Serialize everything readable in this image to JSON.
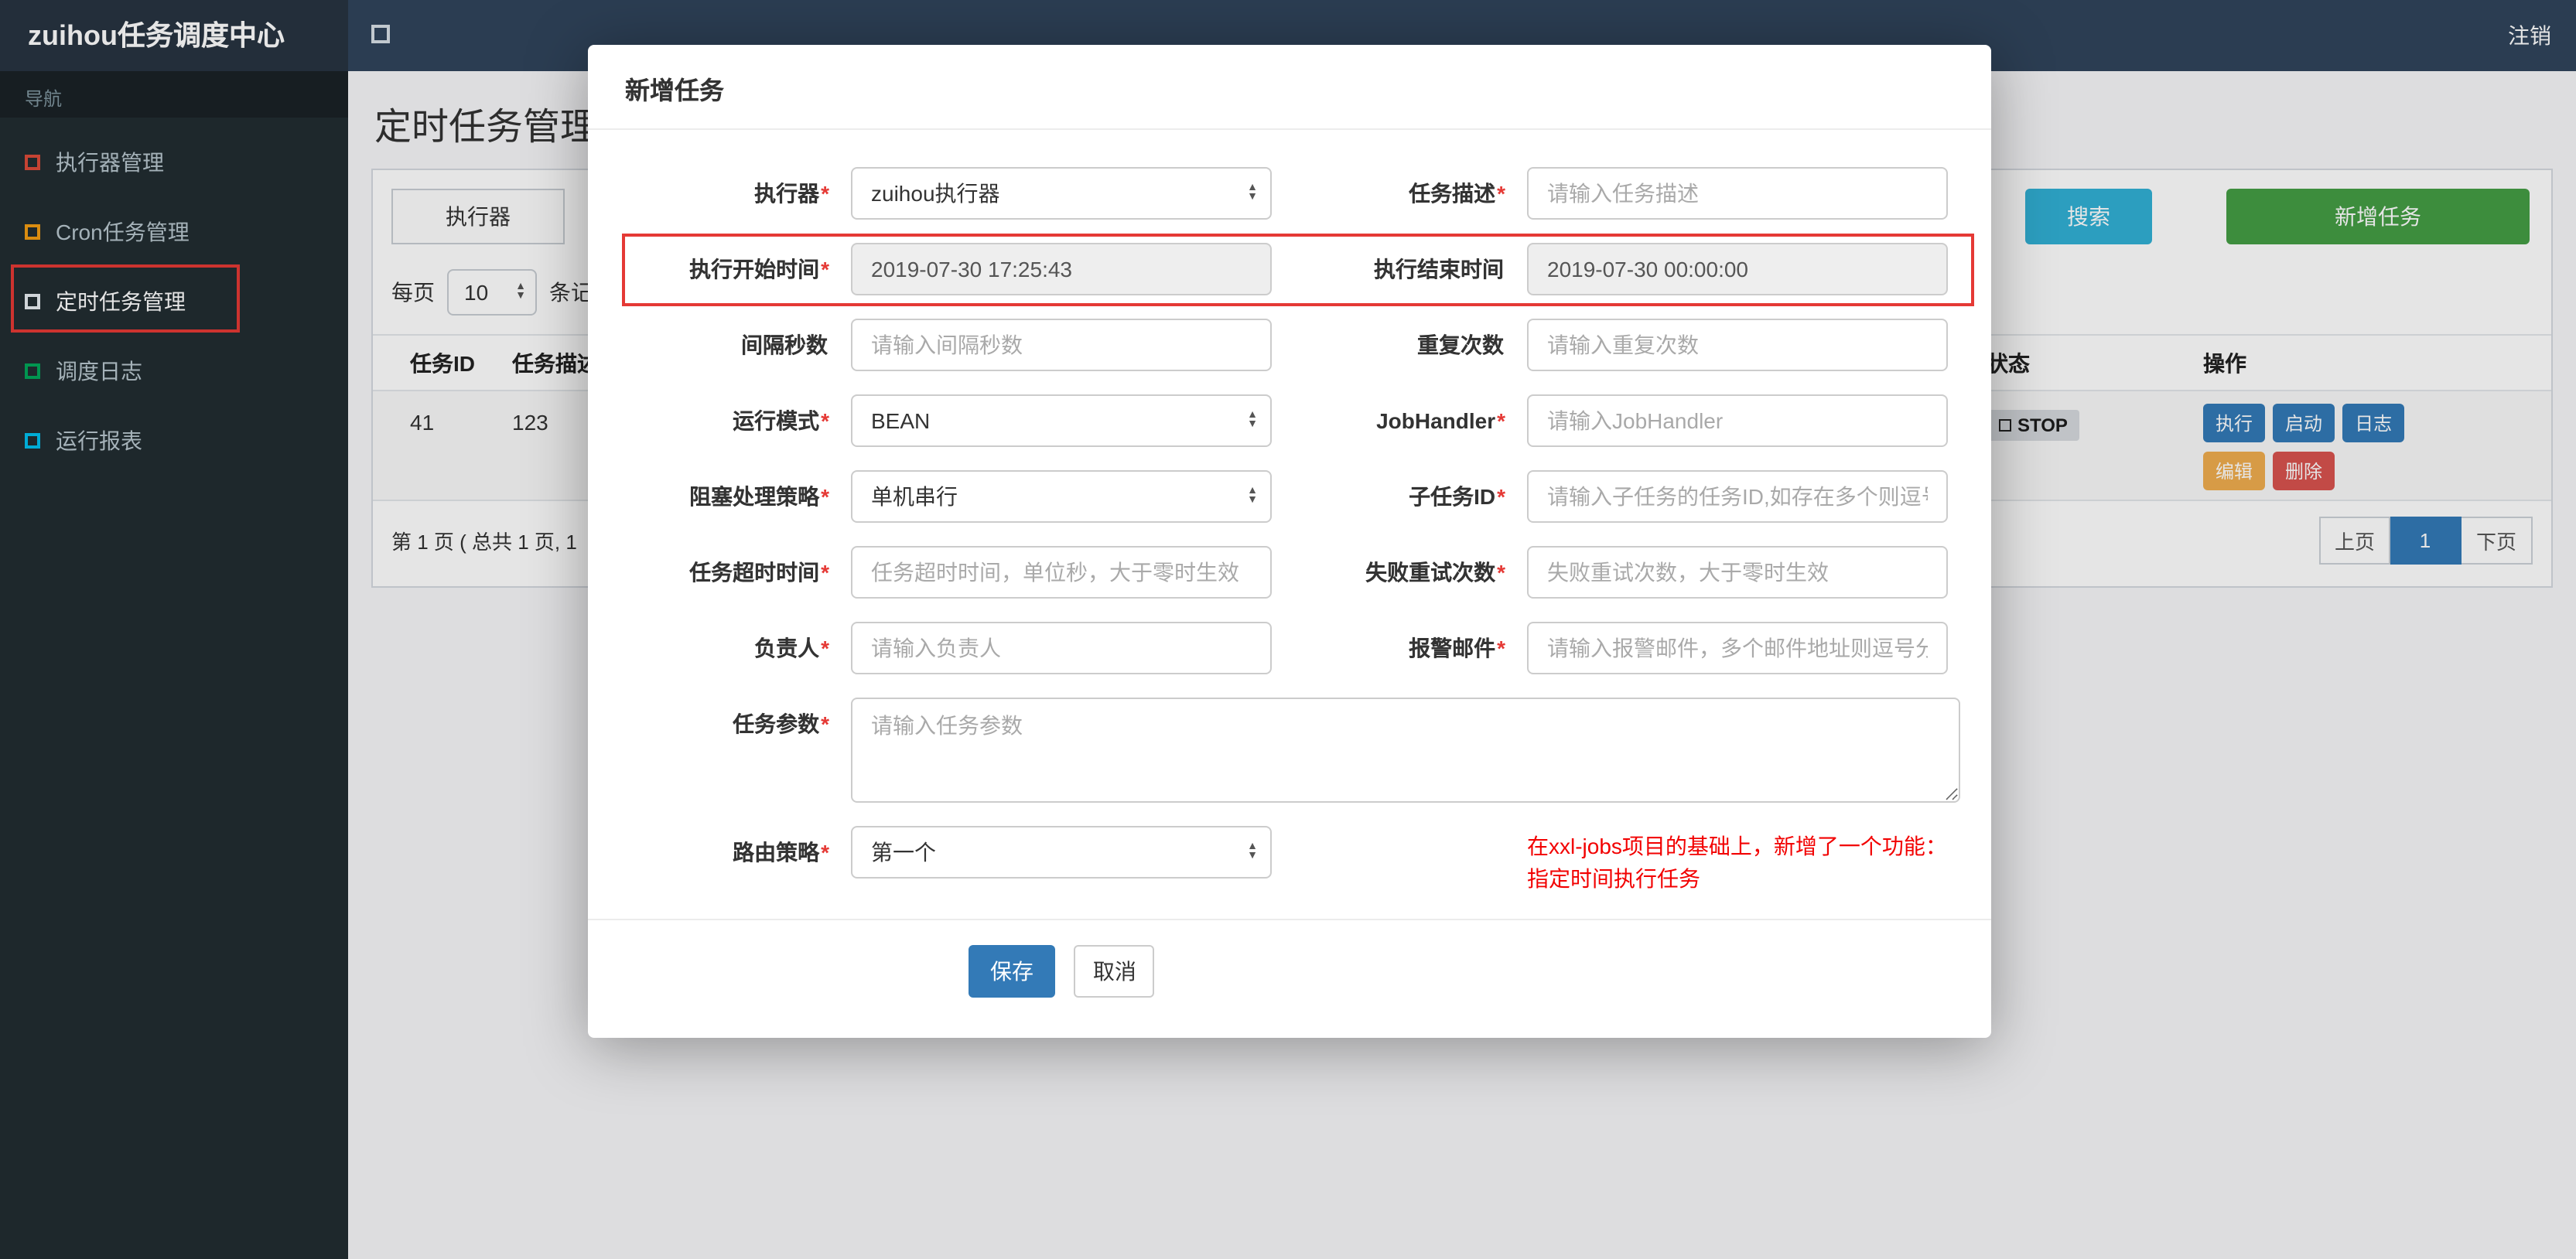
{
  "colors": {
    "navbar_bg": "#30455c",
    "logo_bg": "#273441",
    "sidebar_bg": "#222d32",
    "accent_blue": "#337ab7",
    "search_teal": "#31b0d5",
    "add_green": "#449d44",
    "edit_orange": "#f0ad4e",
    "delete_red": "#d9534f",
    "annotation_red": "#e53935",
    "icon_red": "#dd4b39",
    "icon_orange": "#f39c12",
    "icon_green": "#00a65a",
    "icon_cyan": "#00c0ef"
  },
  "navbar": {
    "brand": "zuihou任务调度中心",
    "logout": "注销"
  },
  "sidebar": {
    "section": "导航",
    "items": [
      {
        "label": "执行器管理"
      },
      {
        "label": "Cron任务管理"
      },
      {
        "label": "定时任务管理"
      },
      {
        "label": "调度日志"
      },
      {
        "label": "运行报表"
      }
    ]
  },
  "page": {
    "title": "定时任务管理",
    "filter_label": "执行器",
    "search_button": "搜索",
    "add_button": "新增任务",
    "per_page_label": "每页",
    "per_page_value": "10",
    "per_page_suffix": "条记录",
    "summary": "第 1 页 ( 总共 1 页, 1",
    "pagination": {
      "prev": "上页",
      "current": "1",
      "next": "下页"
    }
  },
  "table": {
    "headers": [
      "任务ID",
      "任务描述",
      "状态",
      "操作"
    ],
    "row": {
      "job_id": "41",
      "job_desc": "123",
      "status": "STOP",
      "actions": [
        "执行",
        "启动",
        "日志",
        "编辑",
        "删除"
      ]
    }
  },
  "modal": {
    "title": "新增任务",
    "rows": [
      {
        "left": {
          "label": "执行器",
          "star": "*",
          "value": "zuihou执行器"
        },
        "right": {
          "label": "任务描述",
          "star": "*",
          "placeholder": "请输入任务描述"
        }
      },
      {
        "left": {
          "label": "执行开始时间",
          "star": "*",
          "value": "2019-07-30 17:25:43"
        },
        "right": {
          "label": "执行结束时间",
          "star": "",
          "value": "2019-07-30 00:00:00"
        }
      },
      {
        "left": {
          "label": "间隔秒数",
          "star": "",
          "placeholder": "请输入间隔秒数"
        },
        "right": {
          "label": "重复次数",
          "star": "",
          "placeholder": "请输入重复次数"
        }
      },
      {
        "left": {
          "label": "运行模式",
          "star": "*",
          "value": "BEAN"
        },
        "right": {
          "label": "JobHandler",
          "star": "*",
          "placeholder": "请输入JobHandler"
        }
      },
      {
        "left": {
          "label": "阻塞处理策略",
          "star": "*",
          "value": "单机串行"
        },
        "right": {
          "label": "子任务ID",
          "star": "*",
          "placeholder": "请输入子任务的任务ID,如存在多个则逗号分隔"
        }
      },
      {
        "left": {
          "label": "任务超时时间",
          "star": "*",
          "placeholder": "任务超时时间，单位秒，大于零时生效"
        },
        "right": {
          "label": "失败重试次数",
          "star": "*",
          "placeholder": "失败重试次数，大于零时生效"
        }
      },
      {
        "left": {
          "label": "负责人",
          "star": "*",
          "placeholder": "请输入负责人"
        },
        "right": {
          "label": "报警邮件",
          "star": "*",
          "placeholder": "请输入报警邮件，多个邮件地址则逗号分隔"
        }
      },
      {
        "full": {
          "label": "任务参数",
          "star": "*",
          "placeholder": "请输入任务参数"
        }
      },
      {
        "left": {
          "label": "路由策略",
          "star": "*",
          "value": "第一个"
        },
        "note": [
          "在xxl-jobs项目的基础上，新增了一个功能：",
          "指定时间执行任务"
        ]
      }
    ],
    "save_button": "保存",
    "cancel_button": "取消"
  }
}
